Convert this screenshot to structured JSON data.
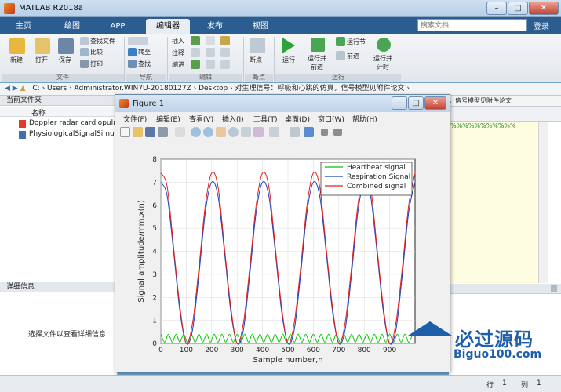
{
  "window": {
    "title": "MATLAB R2018a",
    "min": "–",
    "max": "□",
    "close": "✕"
  },
  "tabs": [
    {
      "label": "主页"
    },
    {
      "label": "绘图"
    },
    {
      "label": "APP"
    },
    {
      "label": "编辑器"
    },
    {
      "label": "发布"
    },
    {
      "label": "视图"
    }
  ],
  "search": {
    "placeholder": "搜索文档"
  },
  "login": "登录",
  "ribbon": {
    "new": "新建",
    "open": "打开",
    "save": "保存",
    "find_files": "查找文件",
    "compare": "比较",
    "print": "打印",
    "goto": "转至",
    "find": "查找",
    "insert": "插入",
    "comment": "注释",
    "indent": "缩进",
    "breakpoint": "断点",
    "run": "运行",
    "run_advance": "运行并\n前进",
    "run_section": "运行节",
    "advance": "前进",
    "run_time": "运行并\n计时",
    "groups": {
      "file": "文件",
      "nav": "导航",
      "edit": "编辑",
      "breakpoint": "断点",
      "run": "运行"
    }
  },
  "address": {
    "path": "C:  ›  Users  ›  Administrator.WIN7U-20180127Z  ›  Desktop  ›  对生理信号：呼吸和心跳的仿真，信号模型见附件论文  ›"
  },
  "current_folder": {
    "header": "当前文件夹",
    "col_name": "名称",
    "files": [
      "Doppler radar cardiopulm",
      "PhysiologicalSignalSimula"
    ]
  },
  "details": {
    "header": "详细信息",
    "hint": "选择文件以查看详细信息"
  },
  "right": {
    "crumb": "，信号模型见附件论文",
    "code": "%%%%%%%%%%%"
  },
  "status": {
    "row_label": "行",
    "row": "1",
    "col_label": "列",
    "col": "1"
  },
  "figure": {
    "title": "Figure 1",
    "menu": [
      "文件(F)",
      "编辑(E)",
      "查看(V)",
      "插入(I)",
      "工具(T)",
      "桌面(D)",
      "窗口(W)",
      "帮助(H)"
    ]
  },
  "watermark": {
    "title": "必过源码",
    "sub": "Biguo100.com"
  },
  "chart_data": {
    "type": "line",
    "xlabel": "Sample number,n",
    "ylabel": "Signal amplitude/mm,x(n)",
    "xlim": [
      0,
      1000
    ],
    "ylim": [
      0,
      8
    ],
    "xticks": [
      0,
      100,
      200,
      300,
      400,
      500,
      600,
      700,
      800,
      900
    ],
    "yticks": [
      0,
      1,
      2,
      3,
      4,
      5,
      6,
      7,
      8
    ],
    "grid": true,
    "legend_position": "top-right",
    "series": [
      {
        "name": "Heartbeat signal",
        "color": "#00c800",
        "x": [
          0,
          15,
          30,
          45,
          60,
          75,
          90,
          105,
          120,
          135,
          150,
          165,
          180,
          195,
          210,
          225,
          240,
          255,
          270,
          285,
          300,
          315,
          330,
          345,
          360,
          375,
          390,
          405,
          420,
          435,
          450,
          465,
          480,
          495,
          510,
          525,
          540,
          555,
          570,
          585,
          600,
          615,
          630,
          645,
          660,
          675,
          690,
          705,
          720,
          735,
          750,
          765,
          780,
          795,
          810,
          825,
          840,
          855,
          870,
          885,
          900,
          915,
          930,
          945,
          960,
          975,
          990
        ],
        "y": [
          0.4,
          0.05,
          0.4,
          0.05,
          0.4,
          0.05,
          0.4,
          0.05,
          0.4,
          0.05,
          0.4,
          0.05,
          0.4,
          0.05,
          0.4,
          0.05,
          0.4,
          0.05,
          0.4,
          0.05,
          0.4,
          0.05,
          0.4,
          0.05,
          0.4,
          0.05,
          0.4,
          0.05,
          0.4,
          0.05,
          0.4,
          0.05,
          0.4,
          0.05,
          0.4,
          0.05,
          0.4,
          0.05,
          0.4,
          0.05,
          0.4,
          0.05,
          0.4,
          0.05,
          0.4,
          0.05,
          0.4,
          0.05,
          0.4,
          0.05,
          0.4,
          0.05,
          0.4,
          0.05,
          0.4,
          0.05,
          0.4,
          0.05,
          0.4,
          0.05,
          0.4,
          0.05,
          0.4,
          0.05,
          0.4,
          0.05,
          0.4
        ]
      },
      {
        "name": "Respiration Signal",
        "color": "#1f3fbf",
        "x": [
          0,
          25,
          50,
          75,
          100,
          125,
          150,
          175,
          200,
          225,
          250,
          275,
          300,
          325,
          350,
          375,
          400,
          425,
          450,
          475,
          500,
          525,
          550,
          575,
          600,
          625,
          650,
          675,
          700,
          725,
          750,
          775,
          800,
          825,
          850,
          875,
          900,
          925,
          950,
          975,
          1000
        ],
        "y": [
          7.0,
          6.4,
          4.0,
          1.4,
          0.0,
          0.6,
          3.0,
          5.7,
          7.0,
          6.4,
          4.0,
          1.4,
          0.0,
          0.6,
          3.0,
          5.7,
          7.0,
          6.4,
          4.0,
          1.4,
          0.0,
          0.6,
          3.0,
          5.7,
          7.0,
          6.4,
          4.0,
          1.4,
          0.0,
          0.6,
          3.0,
          5.7,
          7.0,
          6.4,
          4.0,
          1.4,
          0.0,
          0.6,
          3.0,
          5.7,
          7.0
        ]
      },
      {
        "name": "Combined signal",
        "color": "#e02020",
        "x": [
          0,
          25,
          50,
          75,
          100,
          125,
          150,
          175,
          200,
          225,
          250,
          275,
          300,
          325,
          350,
          375,
          400,
          425,
          450,
          475,
          500,
          525,
          550,
          575,
          600,
          625,
          650,
          675,
          700,
          725,
          750,
          775,
          800,
          825,
          850,
          875,
          900,
          925,
          950,
          975,
          1000
        ],
        "y": [
          7.4,
          6.8,
          4.2,
          1.6,
          0.0,
          0.9,
          3.3,
          6.0,
          7.4,
          6.8,
          4.2,
          1.6,
          0.0,
          0.9,
          3.3,
          6.0,
          7.4,
          6.8,
          4.2,
          1.6,
          0.0,
          0.9,
          3.3,
          6.0,
          7.4,
          6.8,
          4.2,
          1.6,
          0.0,
          0.9,
          3.3,
          6.0,
          7.4,
          6.8,
          4.2,
          1.6,
          0.0,
          0.9,
          3.3,
          6.0,
          7.4
        ]
      }
    ]
  }
}
